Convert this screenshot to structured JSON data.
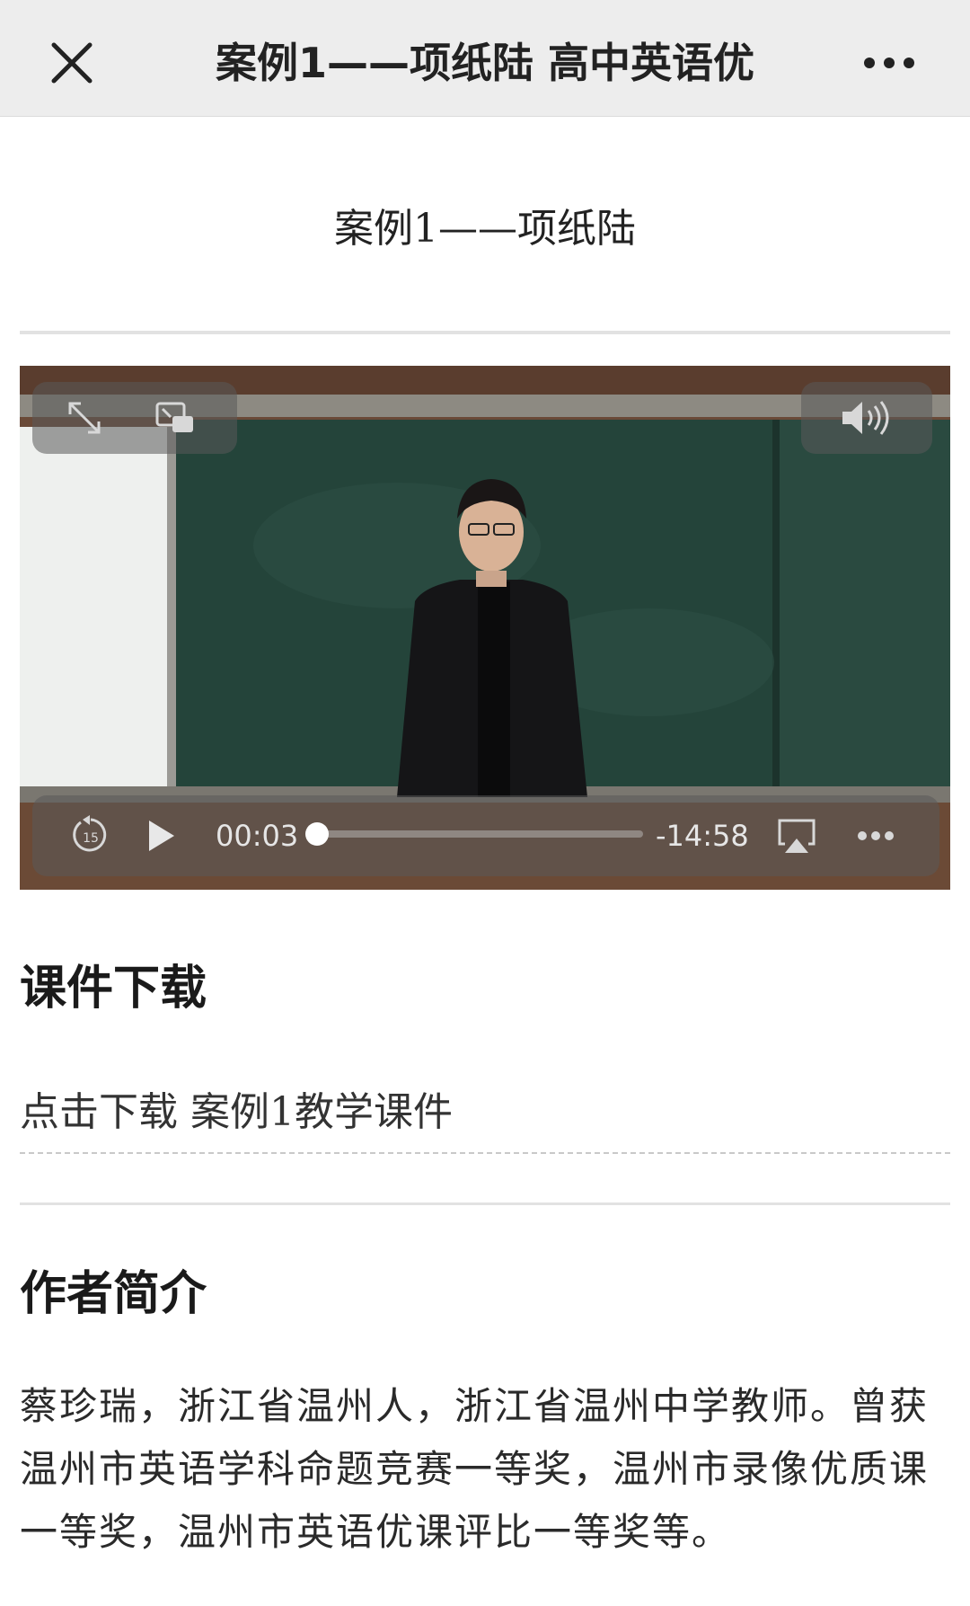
{
  "navbar": {
    "title": "案例1——项纸陆 高中英语优",
    "close_icon": "close-icon",
    "more_icon": "more-dots-icon"
  },
  "article": {
    "title": "案例1——项纸陆"
  },
  "video": {
    "current_time": "00:03",
    "remaining_time": "-14:58",
    "progress_fraction": 0.003,
    "rewind_seconds": "15",
    "icons": [
      "fullscreen-icon",
      "picture-in-picture-icon",
      "volume-icon",
      "rewind-15-icon",
      "play-icon",
      "airplay-icon",
      "more-dots-icon"
    ]
  },
  "courseware": {
    "heading": "课件下载",
    "link_text": "点击下载 案例1教学课件"
  },
  "author": {
    "heading": "作者简介",
    "bio": "蔡珍瑞，浙江省温州人，浙江省温州中学教师。曾获温州市英语学科命题竞赛一等奖，温州市录像优质课一等奖，温州市英语优课评比一等奖等。"
  },
  "colors": {
    "navbar_bg": "#ededed",
    "text": "#1f1f1f",
    "divider": "#e2e2e2"
  }
}
